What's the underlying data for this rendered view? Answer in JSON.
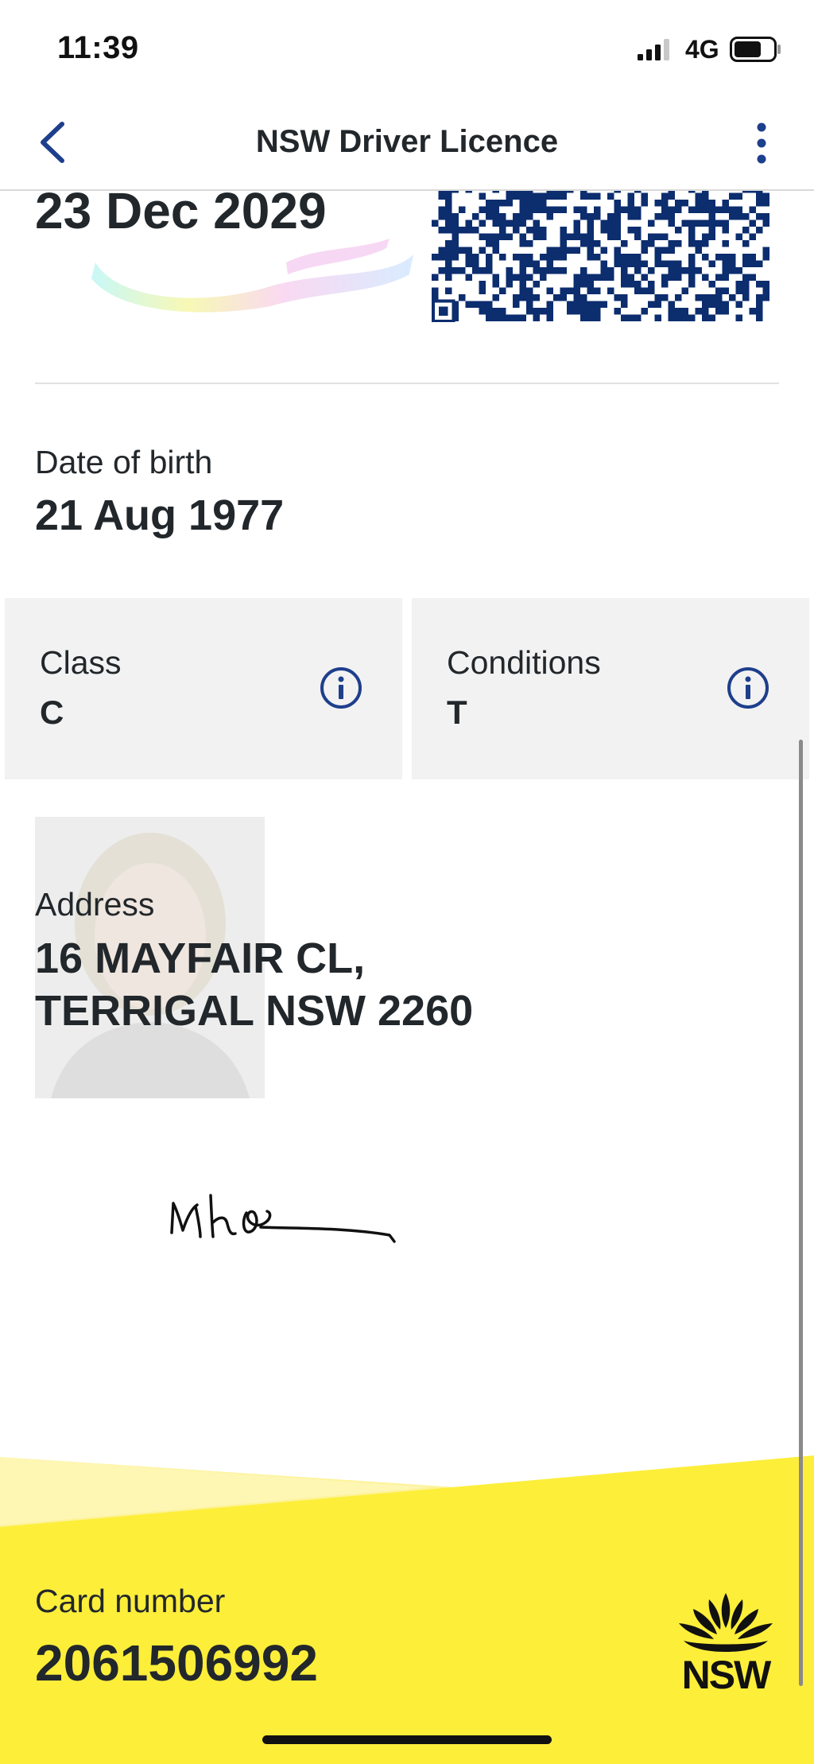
{
  "status_bar": {
    "time": "11:39",
    "network": "4G",
    "icons": [
      "signal-icon",
      "battery-icon"
    ]
  },
  "nav": {
    "title": "NSW Driver Licence",
    "back_icon": "chevron-left-icon",
    "more_icon": "more-vertical-icon"
  },
  "licence": {
    "expiry": "23 Dec 2029",
    "date_of_birth": {
      "label": "Date of birth",
      "value": "21 Aug 1977"
    },
    "class": {
      "label": "Class",
      "value": "C",
      "icon": "info-icon"
    },
    "conditions": {
      "label": "Conditions",
      "value": "T",
      "icon": "info-icon"
    },
    "address": {
      "label": "Address",
      "line1": "16 MAYFAIR CL,",
      "line2": "TERRIGAL NSW 2260"
    },
    "card_number": {
      "label": "Card number",
      "value": "2061506992"
    }
  },
  "branding": {
    "logo_text": "NSW"
  },
  "colors": {
    "accent_blue": "#1d3f8c",
    "qr_blue": "#0c2d6e",
    "footer_yellow": "#fdee3a",
    "card_grey": "#f2f2f2"
  }
}
